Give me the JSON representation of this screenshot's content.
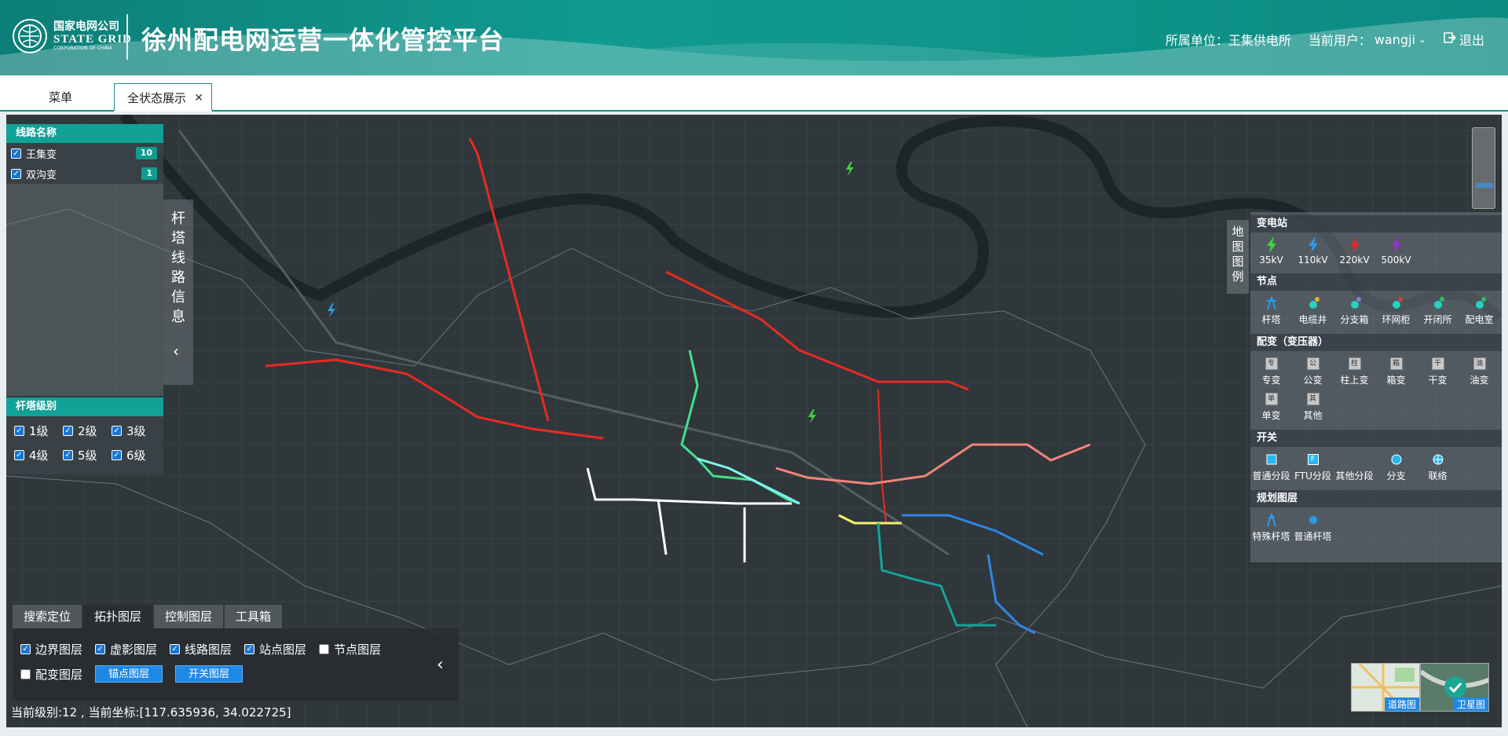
{
  "header": {
    "logo_cn": "国家电网公司",
    "logo_en": "STATE GRID",
    "logo_sub": "CORPORATION OF CHINA",
    "title": "徐州配电网运营一体化管控平台",
    "unit_label": "所属单位：王集供电所",
    "user_label": "当前用户：",
    "user_name": "wangji",
    "logout": "退出"
  },
  "tabs": [
    {
      "label": "菜单"
    },
    {
      "label": "全状态展示",
      "active": true
    }
  ],
  "lines_panel": {
    "title": "线路名称",
    "items": [
      {
        "label": "王集变",
        "count": "10",
        "checked": true
      },
      {
        "label": "双沟变",
        "count": "1",
        "checked": true
      }
    ]
  },
  "tower_info_label": "杆塔线路信息",
  "tower_level_panel": {
    "title": "杆塔级别",
    "levels": [
      {
        "label": "1级",
        "checked": true
      },
      {
        "label": "2级",
        "checked": true
      },
      {
        "label": "3级",
        "checked": true
      },
      {
        "label": "4级",
        "checked": true
      },
      {
        "label": "5级",
        "checked": true
      },
      {
        "label": "6级",
        "checked": true
      }
    ]
  },
  "tool_tabs": [
    {
      "label": "搜索定位"
    },
    {
      "label": "拓扑图层",
      "active": true
    },
    {
      "label": "控制图层"
    },
    {
      "label": "工具箱"
    }
  ],
  "layers": {
    "row1": [
      {
        "label": "边界图层",
        "checked": true
      },
      {
        "label": "虚影图层",
        "checked": true
      },
      {
        "label": "线路图层",
        "checked": true
      },
      {
        "label": "站点图层",
        "checked": true
      },
      {
        "label": "节点图层",
        "checked": false
      }
    ],
    "row2_check": {
      "label": "配变图层",
      "checked": false
    },
    "buttons": [
      "锚点图层",
      "开关图层"
    ]
  },
  "status": {
    "text": "当前级别:12 , 当前坐标:[117.635936, 34.022725]"
  },
  "legend": {
    "label": "地图图例",
    "sections": [
      {
        "title": "变电站",
        "items": [
          {
            "label": "35kV",
            "icon": "bolt-green-icon",
            "color": "#3bd63b"
          },
          {
            "label": "110kV",
            "icon": "bolt-blue-icon",
            "color": "#2b9be8"
          },
          {
            "label": "220kV",
            "icon": "bolt-red-icon",
            "color": "#e8252b"
          },
          {
            "label": "500kV",
            "icon": "bolt-purple-icon",
            "color": "#9a2ed0"
          }
        ]
      },
      {
        "title": "节点",
        "items": [
          {
            "label": "杆塔",
            "icon": "tower-icon"
          },
          {
            "label": "电缆井",
            "icon": "cable-well-icon"
          },
          {
            "label": "分支箱",
            "icon": "branch-box-icon"
          },
          {
            "label": "环网柜",
            "icon": "ring-cabinet-icon"
          },
          {
            "label": "开闭所",
            "icon": "switch-station-icon"
          },
          {
            "label": "配电室",
            "icon": "distribution-room-icon"
          }
        ]
      },
      {
        "title": "配变（变压器）",
        "items": [
          {
            "label": "专变",
            "icon": "transformer-icon",
            "glyph": "专"
          },
          {
            "label": "公变",
            "icon": "transformer-icon",
            "glyph": "公"
          },
          {
            "label": "柱上变",
            "icon": "transformer-icon",
            "glyph": "柱"
          },
          {
            "label": "箱变",
            "icon": "transformer-icon",
            "glyph": "箱"
          },
          {
            "label": "干变",
            "icon": "transformer-icon",
            "glyph": "干"
          },
          {
            "label": "油变",
            "icon": "transformer-icon",
            "glyph": "油"
          },
          {
            "label": "单变",
            "icon": "transformer-icon",
            "glyph": "单"
          },
          {
            "label": "其他",
            "icon": "transformer-icon",
            "glyph": "其"
          }
        ]
      },
      {
        "title": "开关",
        "items": [
          {
            "label": "普通分段",
            "icon": "switch-square-icon"
          },
          {
            "label": "FTU分段",
            "icon": "ftu-icon",
            "glyph": "F"
          },
          {
            "label": "其他分段",
            "icon": "none"
          },
          {
            "label": "分支",
            "icon": "branch-circle-icon"
          },
          {
            "label": "联络",
            "icon": "tie-icon"
          }
        ]
      },
      {
        "title": "规划图层",
        "items": [
          {
            "label": "特殊杆塔",
            "icon": "special-tower-icon"
          },
          {
            "label": "普通杆塔",
            "icon": "normal-tower-icon"
          }
        ]
      }
    ]
  },
  "map_switch": {
    "road": "道路图",
    "satellite": "卫星图"
  }
}
